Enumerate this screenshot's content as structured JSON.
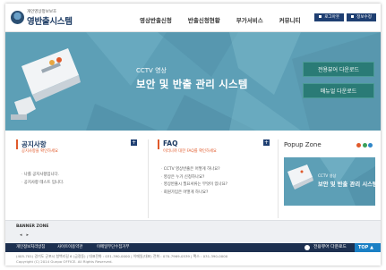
{
  "header": {
    "logo_sub": "개인영상정보보호",
    "logo_main": "영반출시스템",
    "menu": [
      "영상반출신청",
      "반출신청현황",
      "부가서비스",
      "커뮤니티"
    ],
    "login_label": "로그아웃",
    "mypage_label": "정보수정"
  },
  "hero": {
    "subtitle": "CCTV 영상",
    "title": "보안 및 반출 관리 시스템",
    "btn_program": "전용뷰어 다운로드",
    "btn_manual": "매뉴얼 다운로드"
  },
  "notice": {
    "title": "공지사항",
    "desc": "공지사항을 확인하세요",
    "items": [
      "나를 공지사항입니다.",
      "공지사항 테스트 입니다."
    ]
  },
  "faq": {
    "title": "FAQ",
    "desc": "이러니까 대한 FAQ를 확인하세요",
    "items": [
      "CCTV 영상반출은 어떻게 하나요?",
      "영상은 누가 신청하나요?",
      "영상반출시 필요서류는 무엇이 있나요?",
      "회원가입은 어떻게 하나요?"
    ]
  },
  "popup": {
    "title": "Popup Zone",
    "img_small": "CCTV 영상",
    "img_big": "보안 및 반출 관리 시스템",
    "dot_colors": [
      "#e05a2b",
      "#3aa05a",
      "#2f86c8"
    ]
  },
  "banner": {
    "title": "BANNER ZONE",
    "prev": "◂",
    "next": "▸"
  },
  "footer_nav": {
    "items": [
      "개인정보처리방침",
      "사이트이용약관",
      "이메일무단수집거부"
    ],
    "download": "전용뷰어 다운로드",
    "top": "TOP"
  },
  "footer": {
    "address": "(405-701) 경기도 군포시 청백리길 6 (금정동)  |  대표전화 : 031-390-0000  |  이메일(대표) 전화 : 070-7969-0539  |  팩스 : 031-390-0000",
    "copyright": "Copyright (C) 2014 Gunpo OFFICE. All Rights Reserved."
  },
  "colors": {
    "brand_navy": "#1f3f72",
    "accent_orange": "#e05a2b",
    "hero_teal": "#5d9fb6",
    "button_teal": "#2a7b76",
    "top_blue": "#1a7fc4"
  }
}
